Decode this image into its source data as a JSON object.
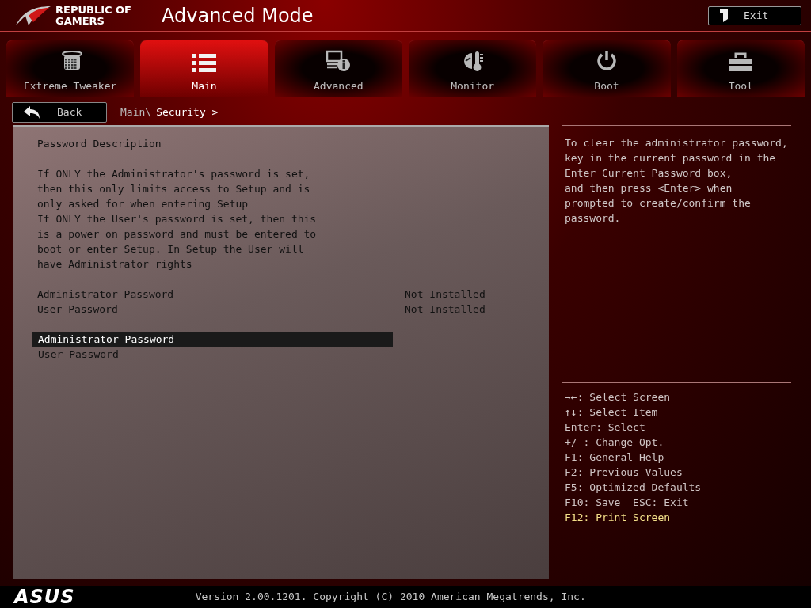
{
  "header": {
    "brand": [
      "REPUBLIC OF",
      "GAMERS"
    ],
    "title": "Advanced Mode",
    "exit_button": "Exit"
  },
  "tabs": [
    {
      "label": "Extreme Tweaker",
      "kind": "tweaker",
      "selected": false
    },
    {
      "label": "Main",
      "kind": "list",
      "selected": true
    },
    {
      "label": "Advanced",
      "kind": "info",
      "selected": false
    },
    {
      "label": "Monitor",
      "kind": "gauge",
      "selected": false
    },
    {
      "label": "Boot",
      "kind": "power",
      "selected": false
    },
    {
      "label": "Tool",
      "kind": "toolbox",
      "selected": false
    }
  ],
  "back_button": "Back",
  "breadcrumb": {
    "parent": "Main\\",
    "current": "Security >"
  },
  "main_panel": {
    "title": "Password Description",
    "paragraphs": [
      "If ONLY the Administrator's password is set, then this only limits access to Setup and is only asked for when entering Setup",
      "If ONLY the User's password is set, then this is a power on password and must be entered to boot or enter Setup. In Setup the User will have Administrator rights"
    ],
    "status_rows": [
      {
        "label": "Administrator Password",
        "value": "Not Installed"
      },
      {
        "label": "User Password",
        "value": "Not Installed"
      }
    ],
    "items": [
      {
        "label": "Administrator Password",
        "selected": true
      },
      {
        "label": "User Password",
        "selected": false
      }
    ]
  },
  "help_text": "To clear the administrator password,\nkey in the current password in the\nEnter Current Password box,\nand then press <Enter> when\nprompted to create/confirm the\npassword.",
  "key_legend": [
    {
      "text": "→←: Select Screen",
      "highlighted": false
    },
    {
      "text": "↑↓: Select Item",
      "highlighted": false
    },
    {
      "text": "Enter: Select",
      "highlighted": false
    },
    {
      "text": "+/-: Change Opt.",
      "highlighted": false
    },
    {
      "text": "F1: General Help",
      "highlighted": false
    },
    {
      "text": "F2: Previous Values",
      "highlighted": false
    },
    {
      "text": "F5: Optimized Defaults",
      "highlighted": false
    },
    {
      "text": "F10: Save  ESC: Exit",
      "highlighted": false
    },
    {
      "text": "F12: Print Screen",
      "highlighted": true
    }
  ],
  "footer": {
    "logo": "ASUS",
    "version": "Version 2.00.1201. Copyright (C) 2010 American Megatrends, Inc."
  }
}
